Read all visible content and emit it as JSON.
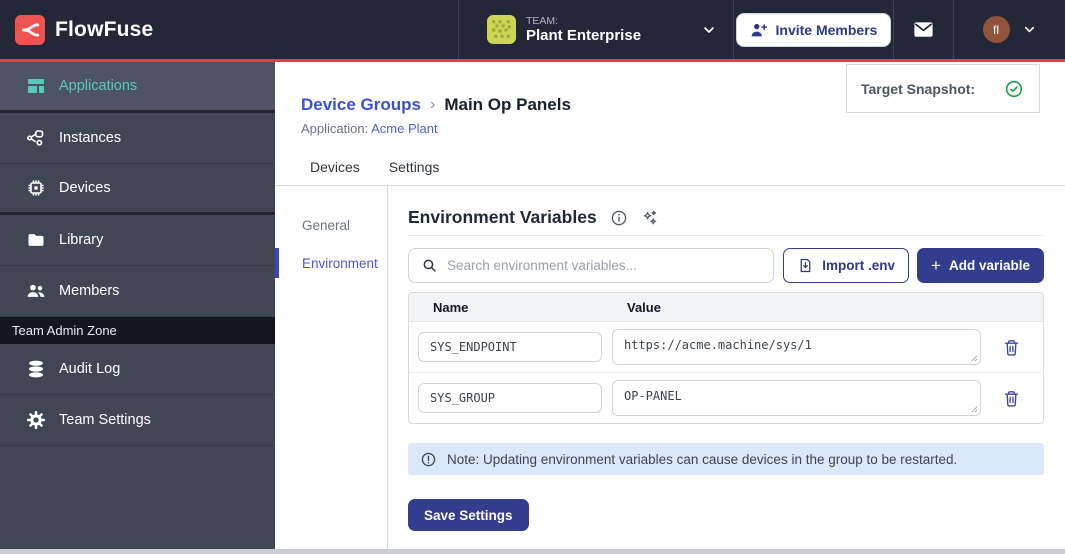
{
  "colors": {
    "header_bg": "#222838",
    "accent_red": "#df463b",
    "logo_red": "#ed5451",
    "sidebar_bg": "#404754",
    "sidebar_active_bg": "#4d5464",
    "sidebar_active_teal": "#5ac8be",
    "admin_band_bg": "#12161f",
    "link_blue": "#3b51d1",
    "indigo_button": "#333d8e",
    "subnav_active": "#4d55d4",
    "note_bg": "#dbe8fb",
    "success_green": "#17a24a",
    "trash_indigo": "#3b479c"
  },
  "header": {
    "brand": "FlowFuse",
    "team_label": "TEAM:",
    "team_name": "Plant Enterprise",
    "invite_label": "Invite Members",
    "avatar_initials": "fl"
  },
  "sidebar": {
    "items": [
      {
        "label": "Applications"
      },
      {
        "label": "Instances"
      },
      {
        "label": "Devices"
      },
      {
        "label": "Library"
      },
      {
        "label": "Members"
      }
    ],
    "admin_zone_label": "Team Admin Zone",
    "admin_items": [
      {
        "label": "Audit Log"
      },
      {
        "label": "Team Settings"
      }
    ]
  },
  "page": {
    "breadcrumb_parent": "Device Groups",
    "breadcrumb_separator": "›",
    "breadcrumb_current": "Main Op Panels",
    "application_label": "Application:",
    "application_name": "Acme Plant",
    "target_snapshot_label": "Target Snapshot:",
    "tabs": [
      {
        "label": "Devices"
      },
      {
        "label": "Settings"
      }
    ],
    "subnav": [
      {
        "label": "General"
      },
      {
        "label": "Environment"
      }
    ]
  },
  "panel": {
    "title": "Environment Variables",
    "search_placeholder": "Search environment variables...",
    "import_label": "Import .env",
    "add_plus": "+",
    "add_label": "Add variable",
    "table": {
      "columns": [
        "Name",
        "Value"
      ],
      "rows": [
        {
          "name": "SYS_ENDPOINT",
          "value": "https://acme.machine/sys/1"
        },
        {
          "name": "SYS_GROUP",
          "value": "OP-PANEL"
        }
      ]
    },
    "note": "Note: Updating environment variables can cause devices in the group to be restarted.",
    "save_label": "Save Settings"
  }
}
